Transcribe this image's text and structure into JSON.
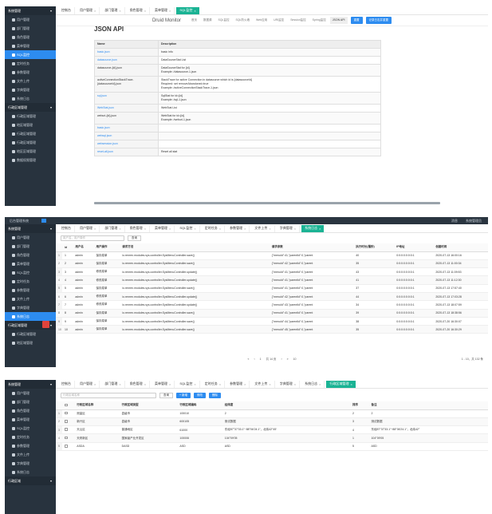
{
  "p1": {
    "sidebar": [
      {
        "type": "sec",
        "label": "系统管理"
      },
      {
        "type": "it",
        "label": "用户管理"
      },
      {
        "type": "it",
        "label": "部门管理"
      },
      {
        "type": "it",
        "label": "角色管理"
      },
      {
        "type": "it",
        "label": "菜单管理"
      },
      {
        "type": "it",
        "label": "SQL监控",
        "active": true
      },
      {
        "type": "it",
        "label": "定时任务"
      },
      {
        "type": "it",
        "label": "参数管理"
      },
      {
        "type": "it",
        "label": "文件上传"
      },
      {
        "type": "it",
        "label": "字典管理"
      },
      {
        "type": "it",
        "label": "系统日志"
      },
      {
        "type": "sec",
        "label": "行政区域管理"
      },
      {
        "type": "it",
        "label": "行政区域管理"
      },
      {
        "type": "it",
        "label": "地区域管理"
      },
      {
        "type": "it",
        "label": "行政区域管理"
      },
      {
        "type": "it",
        "label": "行政区域管理"
      },
      {
        "type": "it",
        "label": "地区区域管理"
      },
      {
        "type": "it",
        "label": "数据权限管理"
      }
    ],
    "tabs": [
      {
        "label": "控制台"
      },
      {
        "label": "用户管理"
      },
      {
        "label": "部门管理"
      },
      {
        "label": "角色管理"
      },
      {
        "label": "菜单管理"
      },
      {
        "label": "SQL监控",
        "active": true
      }
    ],
    "druid": {
      "brand": "Druid Monitor",
      "nav": [
        "首页",
        "数据源",
        "SQL监控",
        "SQL防火墙",
        "Web应用",
        "URI监控",
        "Session监控",
        "Spring监控",
        "JSON API"
      ],
      "nav_selected_index": 8,
      "reset_label": "重置",
      "reset_all_label": "记录日志并重置"
    },
    "json_title": "JSON API",
    "json_rows": [
      {
        "name": "Name",
        "desc": "Description",
        "header": true
      },
      {
        "name": "basic.json",
        "desc": "basic info",
        "link": true
      },
      {
        "name": "datasource.json",
        "desc": "DataSourceStat List",
        "link": true
      },
      {
        "name": "datasource-{id}.json",
        "desc": "DataSourceStat for {id}\nExample: /datasource-1.json",
        "link": false
      },
      {
        "name": "activeConnectionStackTrace-{datasourceId}.json",
        "desc": "StackTrace for active Connection in datasource which id is {datasourceId}\nRequired: set removeAbandoned=true\nExample: /activeConnectionStackTrace-1.json",
        "link": false
      },
      {
        "name": "sql.json",
        "desc": "SqlStat for id={id}\nExample: /sql-1.json",
        "link": true
      },
      {
        "name": "WebStat.json",
        "desc": "WebStat List",
        "link": true
      },
      {
        "name": "weburi-{id}.json",
        "desc": "WebStat for id={id}\nExample: /weburi-1.json",
        "link": false
      },
      {
        "name": "basic.json",
        "desc": "",
        "link": true
      },
      {
        "name": "websql.json",
        "desc": "",
        "link": true
      },
      {
        "name": "websession.json",
        "desc": "",
        "link": true
      },
      {
        "name": "reset-all.json",
        "desc": "Reset all stat",
        "link": true
      }
    ]
  },
  "p2": {
    "top_title": "后台管理系统",
    "top_right": [
      "消息",
      "系统管理员"
    ],
    "sidebar": [
      {
        "type": "sec",
        "label": "系统管理"
      },
      {
        "type": "it",
        "label": "用户管理"
      },
      {
        "type": "it",
        "label": "部门管理"
      },
      {
        "type": "it",
        "label": "角色管理"
      },
      {
        "type": "it",
        "label": "菜单管理"
      },
      {
        "type": "it",
        "label": "SQL监控"
      },
      {
        "type": "it",
        "label": "定时任务"
      },
      {
        "type": "it",
        "label": "参数管理"
      },
      {
        "type": "it",
        "label": "文件上传"
      },
      {
        "type": "it",
        "label": "字典管理"
      },
      {
        "type": "it",
        "label": "系统日志",
        "active": true
      },
      {
        "type": "sec",
        "label": "行政区域管理"
      },
      {
        "type": "it",
        "label": "行政区域管理"
      },
      {
        "type": "it",
        "label": "地区域管理"
      }
    ],
    "tabs": [
      {
        "label": "控制台"
      },
      {
        "label": "用户管理"
      },
      {
        "label": "部门管理"
      },
      {
        "label": "角色管理"
      },
      {
        "label": "菜单管理"
      },
      {
        "label": "SQL监控"
      },
      {
        "label": "定时任务"
      },
      {
        "label": "参数管理"
      },
      {
        "label": "文件上传"
      },
      {
        "label": "字典管理"
      },
      {
        "label": "系统日志",
        "active": true
      }
    ],
    "search_placeholder": "用户名、用户操作",
    "search_label": "查询",
    "columns": [
      "id",
      "用户名",
      "用户操作",
      "请求方法",
      "请求参数",
      "执行时长(毫秒)",
      "IP地址",
      "创建时间"
    ],
    "rows": [
      [
        "1",
        "admin",
        "保存菜单",
        "io.renren.modules.sys.controller.SysMenuController.save()",
        "{\"menuId\":41,\"parentId\":0,\"parent",
        "40",
        "0:0:0:0:0:0:0:1",
        "2020-07-13 16:00:16"
      ],
      [
        "2",
        "admin",
        "保存菜单",
        "io.renren.modules.sys.controller.SysMenuController.save()",
        "{\"menuId\":42,\"parentId\":0,\"parent",
        "35",
        "0:0:0:0:0:0:0:1",
        "2020-07-13 11:00:34"
      ],
      [
        "3",
        "admin",
        "修改菜单",
        "io.renren.modules.sys.controller.SysMenuController.update()",
        "{\"menuId\":41,\"parentId\":0,\"parent",
        "43",
        "0:0:0:0:0:0:0:1",
        "2020-07-13 11:09:53"
      ],
      [
        "4",
        "admin",
        "修改菜单",
        "io.renren.modules.sys.controller.SysMenuController.update()",
        "{\"menuId\":41,\"parentId\":0,\"parent",
        "41",
        "0:0:0:0:0:0:0:1",
        "2020-07-13 11:12:30"
      ],
      [
        "5",
        "admin",
        "保存菜单",
        "io.renren.modules.sys.controller.SysMenuController.save()",
        "{\"menuId\":41,\"parentId\":0,\"parent",
        "37",
        "0:0:0:0:0:0:0:1",
        "2020-07-13 17:57:40"
      ],
      [
        "6",
        "admin",
        "修改菜单",
        "io.renren.modules.sys.controller.SysMenuController.update()",
        "{\"menuId\":42,\"parentId\":0,\"parent",
        "44",
        "0:0:0:0:0:0:0:1",
        "2020-07-13 17:03:28"
      ],
      [
        "7",
        "admin",
        "修改菜单",
        "io.renren.modules.sys.controller.SysMenuController.update()",
        "{\"menuId\":43,\"parentId\":0,\"parent",
        "34",
        "0:0:0:0:0:0:0:1",
        "2020-07-13 18:07:59"
      ],
      [
        "8",
        "admin",
        "保存菜单",
        "io.renren.modules.sys.controller.SysMenuController.save()",
        "{\"menuId\":41,\"parentId\":0,\"parent",
        "39",
        "0:0:0:0:0:0:0:1",
        "2020-07-13 18:38:56"
      ],
      [
        "9",
        "admin",
        "保存菜单",
        "io.renren.modules.sys.controller.SysMenuController.save()",
        "{\"menuId\":44,\"parentId\":0,\"parent",
        "38",
        "0:0:0:0:0:0:0:1",
        "2020-07-20 16:30:07"
      ],
      [
        "10",
        "admin",
        "保存菜单",
        "io.renren.modules.sys.controller.SysMenuController.save()",
        "{\"menuId\":45,\"parentId\":0,\"parent",
        "35",
        "0:0:0:0:0:0:0:1",
        "2020-07-20 16:30:29"
      ]
    ],
    "pager": {
      "current": "1",
      "pages": "共 14 页",
      "per_page": "10",
      "total": "1 - 10，共 132 条"
    }
  },
  "p3": {
    "sidebar": [
      {
        "type": "sec",
        "label": "系统管理"
      },
      {
        "type": "it",
        "label": "用户管理"
      },
      {
        "type": "it",
        "label": "部门管理"
      },
      {
        "type": "it",
        "label": "角色管理"
      },
      {
        "type": "it",
        "label": "菜单管理"
      },
      {
        "type": "it",
        "label": "SQL监控"
      },
      {
        "type": "it",
        "label": "定时任务"
      },
      {
        "type": "it",
        "label": "参数管理"
      },
      {
        "type": "it",
        "label": "文件上传"
      },
      {
        "type": "it",
        "label": "字典管理"
      },
      {
        "type": "it",
        "label": "系统日志"
      },
      {
        "type": "sec",
        "label": "行政区域"
      }
    ],
    "tabs": [
      {
        "label": "控制台"
      },
      {
        "label": "用户管理"
      },
      {
        "label": "部门管理"
      },
      {
        "label": "角色管理"
      },
      {
        "label": "菜单管理"
      },
      {
        "label": "SQL监控"
      },
      {
        "label": "定时任务"
      },
      {
        "label": "参数管理"
      },
      {
        "label": "文件上传"
      },
      {
        "label": "字典管理"
      },
      {
        "label": "系统日志"
      },
      {
        "label": "行政区域管理",
        "active": true
      }
    ],
    "search_placeholder": "行政区域名称",
    "search_label": "查询",
    "add_label": "+ 新增",
    "edit_label": "修改",
    "delete_label": "删除",
    "columns": [
      "",
      "行政区域名称",
      "行政区域类型",
      "行政区域编码",
      "经纬度",
      "排序",
      "备注"
    ],
    "rows": [
      [
        "1",
        "测量区",
        "县级市",
        "100010",
        "2",
        "2",
        "2"
      ],
      [
        "2",
        "新兴区",
        "县级市",
        "600105",
        "测试数据",
        "3",
        "测试数据"
      ],
      [
        "3",
        "天山区",
        "普通地区",
        "61000",
        "东经87°37'33.1\"~88°06'24.1\"，北纬42°45'",
        "4",
        "东经87°37'33.1\"~88°06'24.1\"，北纬42°"
      ],
      [
        "4",
        "天府新区",
        "国家级产业开发区",
        "100006",
        "104°09'05",
        "1",
        "104°09'05"
      ],
      [
        "5",
        "ASDA",
        "DASD",
        "ASD",
        "ASD",
        "5",
        "ASD"
      ]
    ]
  }
}
